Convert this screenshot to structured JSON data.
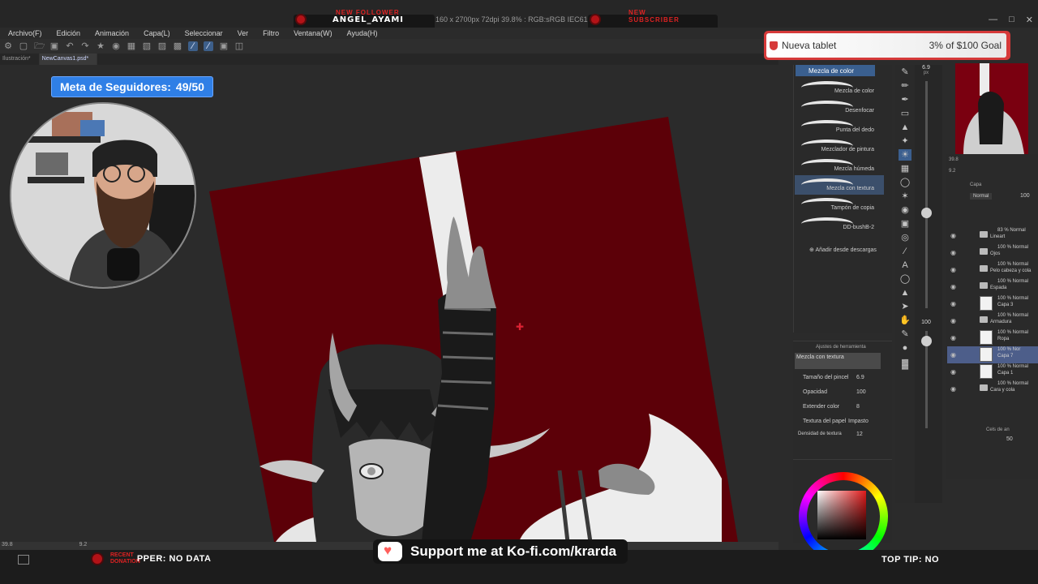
{
  "stream": {
    "new_follower_label": "NEW FOLLOWER",
    "new_follower_value": "ANGEL_AYAMI",
    "new_subscriber_label": "NEW SUBSCRIBER",
    "follower_goal_label": "Meta de Seguidores:",
    "follower_goal_value": "49/50",
    "tablet_goal_name": "Nueva tablet",
    "tablet_goal_progress": "3% of $100 Goal",
    "tablet_goal_fraction": 0.03,
    "recent_donation_label_1": "RECENT",
    "recent_donation_label_2": "DONATION",
    "donation_ticker": "PPER: NO DATA",
    "kofi_text": "Support me at Ko-fi.com/krarda",
    "top_tip": "TOP TIP: NO"
  },
  "app": {
    "doc_info": "160 x 2700px 72dpi 39.8% : RGB:sRGB IEC61966-2.1)",
    "menu": [
      "Archivo(F)",
      "Edición",
      "Animación",
      "Capa(L)",
      "Seleccionar",
      "Ver",
      "Filtro",
      "Ventana(W)",
      "Ayuda(H)"
    ],
    "tabs": [
      "Ilustración*",
      "NewCanvas1.psd*"
    ],
    "status_zoom": "39.8",
    "status_angle": "9.2"
  },
  "subtool": {
    "header": "Mezcla de color",
    "brushes": [
      "Mezcla de color",
      "Desenfocar",
      "Punta del dedo",
      "Mezclador de pintura",
      "Mezcla húmeda",
      "Mezcla con textura",
      "Tampón de copia",
      "DD-bushB-2"
    ],
    "active_index": 5,
    "add_from_downloads": "Añadir desde descargas"
  },
  "tool_property": {
    "title": "Ajustes de herramienta",
    "brush_name": "Mezcla con textura",
    "props": [
      {
        "label": "Tamaño del pincel",
        "value": "6.9"
      },
      {
        "label": "Opacidad",
        "value": "100"
      },
      {
        "label": "Extender color",
        "value": "8"
      },
      {
        "label": "Textura del papel",
        "value": "Impasto"
      },
      {
        "label": "Densidad de textura",
        "value": "12"
      }
    ]
  },
  "brush_size_readout": "6.9",
  "brush_size_unit": "px",
  "opacity_readout": "100",
  "layers": {
    "tab_label": "Capa",
    "blend_mode": "Normal",
    "opacity": "100",
    "items": [
      {
        "pct": "83 % Normal",
        "name": "Lineart",
        "type": "folder"
      },
      {
        "pct": "100 % Normal",
        "name": "Ojos",
        "type": "folder"
      },
      {
        "pct": "100 % Normal",
        "name": "Pelo cabeza y cola",
        "type": "folder"
      },
      {
        "pct": "100 % Normal",
        "name": "Espada",
        "type": "folder"
      },
      {
        "pct": "100 % Normal",
        "name": "Capa 3",
        "type": "layer"
      },
      {
        "pct": "100 % Normal",
        "name": "Armadura",
        "type": "folder"
      },
      {
        "pct": "100 % Normal",
        "name": "Ropa",
        "type": "layer"
      },
      {
        "pct": "100 % Nor",
        "name": "Capa 7",
        "type": "layer",
        "selected": true
      },
      {
        "pct": "100 % Normal",
        "name": "Capa 1",
        "type": "layer"
      },
      {
        "pct": "100 % Normal",
        "name": "Cara y cola",
        "type": "folder"
      }
    ],
    "cels_label": "Cels de an",
    "cels_value": "50"
  },
  "colors": {
    "canvas_red": "#5c0008",
    "accent_blue": "#2f7fe6",
    "alert_red": "#b31217",
    "kofi_red": "#ff5e5b"
  }
}
